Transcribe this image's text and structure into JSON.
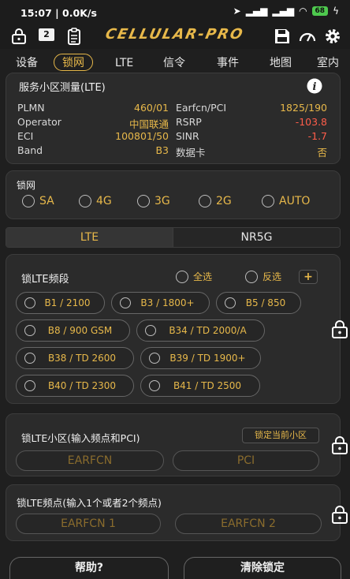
{
  "status_bar": {
    "time": "15:07 | 0.0K/s",
    "battery": "68"
  },
  "app": {
    "logo": "CELLULAR-PRO",
    "badge": "2"
  },
  "tabs": [
    "设备",
    "锁网",
    "LTE",
    "信令",
    "事件",
    "地图",
    "室内"
  ],
  "active_tab": "锁网",
  "serving_cell": {
    "title": "服务小区测量(LTE)",
    "rows": [
      {
        "l1": "PLMN",
        "v1": "460/01",
        "l2": "Earfcn/PCI",
        "v2": "1825/190"
      },
      {
        "l1": "Operator",
        "v1": "中国联通",
        "l2": "RSRP",
        "v2": "-103.8"
      },
      {
        "l1": "ECI",
        "v1": "100801/50",
        "l2": "SINR",
        "v2": "-1.7"
      },
      {
        "l1": "Band",
        "v1": "B3",
        "l2": "数据卡",
        "v2": "否"
      }
    ]
  },
  "lock_network": {
    "title": "锁网",
    "options": [
      "SA",
      "4G",
      "3G",
      "2G",
      "AUTO"
    ]
  },
  "segment": {
    "lte": "LTE",
    "nr5g": "NR5G"
  },
  "lte_band": {
    "title": "锁LTE频段",
    "select_all": "全选",
    "invert": "反选",
    "add": "+",
    "bands": [
      "B1 / 2100",
      "B3 / 1800+",
      "B5 / 850",
      "B8 / 900 GSM",
      "B34 / TD 2000/A",
      "B38 / TD 2600",
      "B39 / TD 1900+",
      "B40 / TD 2300",
      "B41 / TD 2500"
    ]
  },
  "lte_cell": {
    "title": "锁LTE小区(输入频点和PCI)",
    "lock_current": "锁定当前小区",
    "earfcn_placeholder": "EARFCN",
    "pci_placeholder": "PCI"
  },
  "lte_freq": {
    "title": "锁LTE频点(输入1个或者2个频点)",
    "earfcn1_placeholder": "EARFCN 1",
    "earfcn2_placeholder": "EARFCN 2"
  },
  "footer": {
    "help": "帮助?",
    "clear": "清除锁定"
  },
  "colors": {
    "accent": "#e7b84a",
    "negative": "#ff5d4a",
    "background": "#1f1f1f"
  }
}
